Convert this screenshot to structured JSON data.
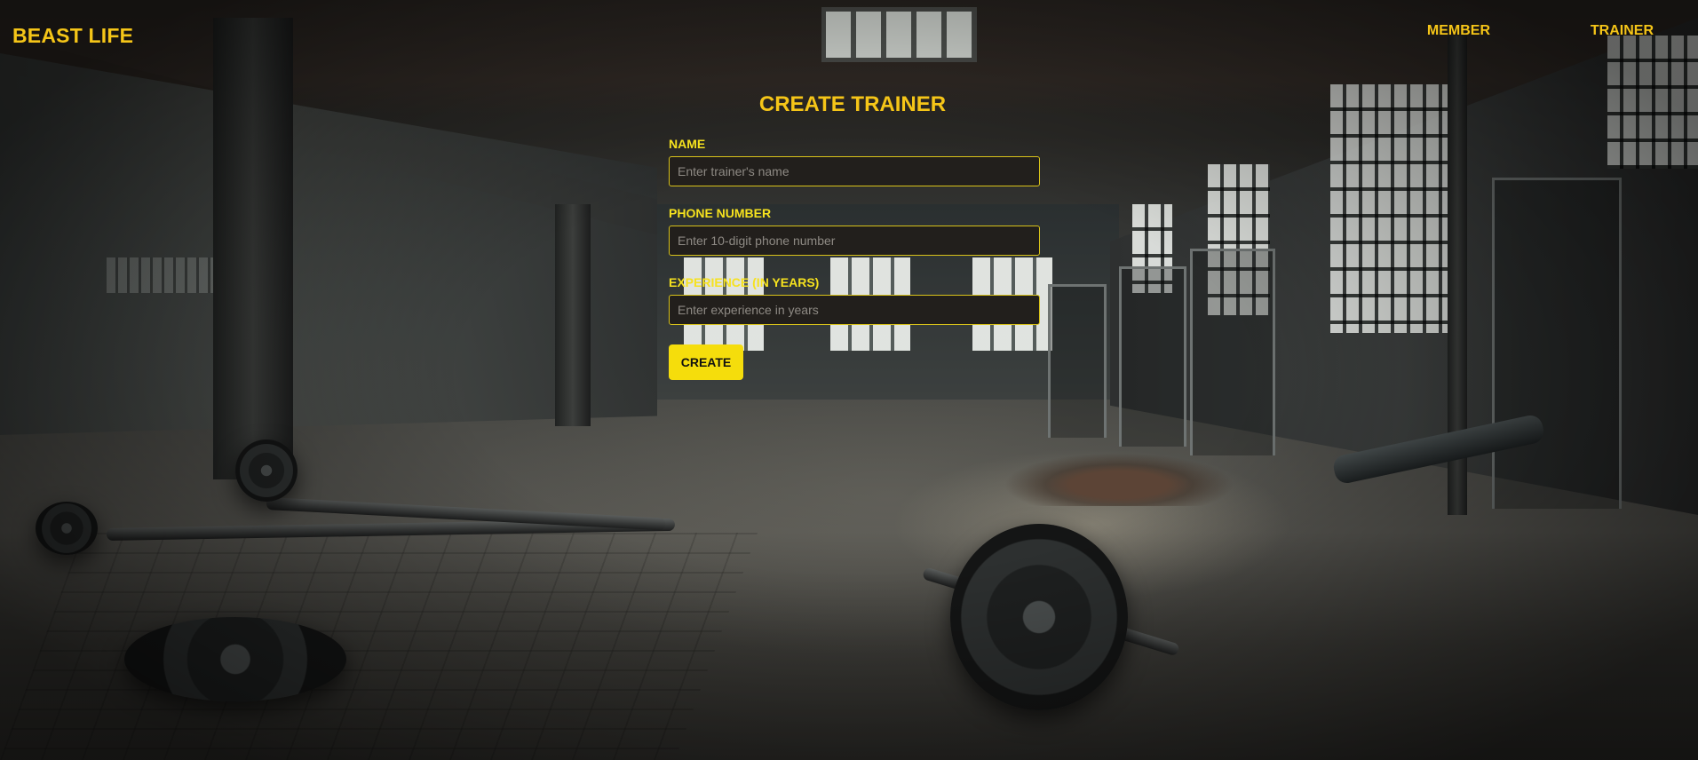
{
  "header": {
    "brand": "BEAST LIFE",
    "nav": [
      {
        "label": "MEMBER"
      },
      {
        "label": "TRAINER"
      }
    ]
  },
  "form": {
    "title": "CREATE TRAINER",
    "fields": [
      {
        "label": "NAME",
        "placeholder": "Enter trainer's name",
        "value": ""
      },
      {
        "label": "PHONE NUMBER",
        "placeholder": "Enter 10-digit phone number",
        "value": ""
      },
      {
        "label": "EXPERIENCE (IN YEARS)",
        "placeholder": "Enter experience in years",
        "value": ""
      }
    ],
    "submit_label": "CREATE"
  },
  "colors": {
    "accent": "#f5c518",
    "label": "#f6e21e",
    "button": "#f5dd0c",
    "input_background": "#221f1c",
    "input_border": "#d8c21a"
  }
}
